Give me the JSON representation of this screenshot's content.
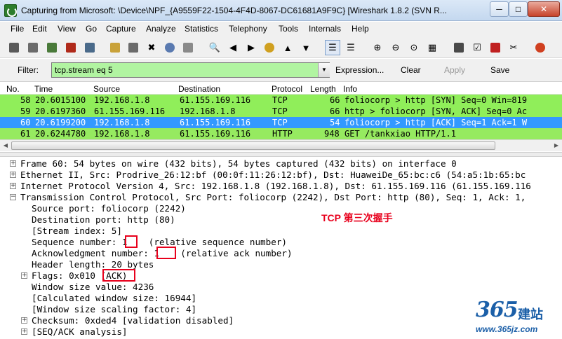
{
  "window": {
    "title": "Capturing from Microsoft: \\Device\\NPF_{A9559F22-1504-4F4D-8067-DC61681A9F9C}   [Wireshark 1.8.2  (SVN R...",
    "min_label": "─",
    "max_label": "□",
    "close_label": "✕"
  },
  "menu": [
    "File",
    "Edit",
    "View",
    "Go",
    "Capture",
    "Analyze",
    "Statistics",
    "Telephony",
    "Tools",
    "Internals",
    "Help"
  ],
  "toolbar": {
    "icons": [
      {
        "name": "interfaces-icon",
        "color": "#5a5a5a"
      },
      {
        "name": "options-icon",
        "color": "#6b6b6b"
      },
      {
        "name": "start-capture-icon",
        "color": "#4a7a3a"
      },
      {
        "name": "stop-capture-icon",
        "color": "#b02a1a"
      },
      {
        "name": "restart-capture-icon",
        "color": "#4a6a8a"
      },
      {
        "name": "open-file-icon",
        "color": "#c9a23a"
      },
      {
        "name": "save-file-icon",
        "color": "#6b6b6b"
      },
      {
        "name": "close-file-icon",
        "color": "#6b6b6b"
      },
      {
        "name": "reload-icon",
        "color": "#5a7ab0"
      },
      {
        "name": "print-icon",
        "color": "#6b6b6b"
      },
      {
        "name": "find-packet-icon",
        "color": "#6b6b6b"
      },
      {
        "name": "go-back-icon",
        "color": "#3a9a2a"
      },
      {
        "name": "go-forward-icon",
        "color": "#3a9a2a"
      },
      {
        "name": "go-to-packet-icon",
        "color": "#d0a020"
      },
      {
        "name": "go-first-icon",
        "color": "#3a9a2a"
      },
      {
        "name": "go-last-icon",
        "color": "#3a9a2a"
      },
      {
        "name": "colorize-icon",
        "color": "#4a4a4a"
      },
      {
        "name": "auto-scroll-icon",
        "color": "#4a4a4a"
      },
      {
        "name": "zoom-in-icon",
        "color": "#4a4a4a"
      },
      {
        "name": "zoom-out-icon",
        "color": "#4a4a4a"
      },
      {
        "name": "normal-size-icon",
        "color": "#4a4a4a"
      },
      {
        "name": "resize-columns-icon",
        "color": "#4a4a4a"
      },
      {
        "name": "capture-filters-icon",
        "color": "#4a4a4a"
      },
      {
        "name": "display-filters-icon",
        "color": "#4a4a4a"
      },
      {
        "name": "coloring-rules-icon",
        "color": "#c02020"
      },
      {
        "name": "preferences-icon",
        "color": "#4a4a4a"
      },
      {
        "name": "help-icon",
        "color": "#d04020"
      }
    ]
  },
  "filter": {
    "label": "Filter:",
    "value": "tcp.stream eq 5",
    "color": "#b1f4a1",
    "buttons": {
      "expression": "Expression...",
      "clear": "Clear",
      "apply": "Apply",
      "save": "Save"
    }
  },
  "packet_list": {
    "columns": [
      "No.",
      "Time",
      "Source",
      "Destination",
      "Protocol",
      "Length",
      "Info"
    ],
    "rows": [
      {
        "no": "58",
        "time": "20.6015100",
        "source": "192.168.1.8",
        "destination": "61.155.169.116",
        "protocol": "TCP",
        "length": "66",
        "info": "foliocorp > http [SYN] Seq=0 Win=819",
        "style": "green"
      },
      {
        "no": "59",
        "time": "20.6197360",
        "source": "61.155.169.116",
        "destination": "192.168.1.8",
        "protocol": "TCP",
        "length": "66",
        "info": "http > foliocorp [SYN, ACK] Seq=0 Ac",
        "style": "green"
      },
      {
        "no": "60",
        "time": "20.6199200",
        "source": "192.168.1.8",
        "destination": "61.155.169.116",
        "protocol": "TCP",
        "length": "54",
        "info": "foliocorp > http [ACK] Seq=1 Ack=1 W",
        "style": "selected"
      },
      {
        "no": "61",
        "time": "20.6244780",
        "source": "192.168.1.8",
        "destination": "61.155.169.116",
        "protocol": "HTTP",
        "length": "948",
        "info": "GET /tankxiao HTTP/1.1",
        "style": "green2"
      }
    ],
    "colors": {
      "green": "#90ee5a",
      "selected": "#3399ff"
    }
  },
  "details": {
    "lines": [
      {
        "text": "Frame 60: 54 bytes on wire (432 bits), 54 bytes captured (432 bits) on interface 0",
        "indent": 0,
        "expander": "+"
      },
      {
        "text": "Ethernet II, Src: Prodrive_26:12:bf (00:0f:11:26:12:bf), Dst: HuaweiDe_65:bc:c6 (54:a5:1b:65:bc",
        "indent": 0,
        "expander": "+"
      },
      {
        "text": "Internet Protocol Version 4, Src: 192.168.1.8 (192.168.1.8), Dst: 61.155.169.116 (61.155.169.116",
        "indent": 0,
        "expander": "+"
      },
      {
        "text": "Transmission Control Protocol, Src Port: foliocorp (2242), Dst Port: http (80), Seq: 1, Ack: 1,",
        "indent": 0,
        "expander": "−"
      },
      {
        "text": "Source port: foliocorp (2242)",
        "indent": 1,
        "expander": ""
      },
      {
        "text": "Destination port: http (80)",
        "indent": 1,
        "expander": ""
      },
      {
        "text": "[Stream index: 5]",
        "indent": 1,
        "expander": ""
      },
      {
        "text": "Sequence number: 1    (relative sequence number)",
        "indent": 1,
        "expander": ""
      },
      {
        "text": "Acknowledgment number: 1    (relative ack number)",
        "indent": 1,
        "expander": ""
      },
      {
        "text": "Header length: 20 bytes",
        "indent": 1,
        "expander": ""
      },
      {
        "text": "Flags: 0x010 (ACK)",
        "indent": 1,
        "expander": "+"
      },
      {
        "text": "Window size value: 4236",
        "indent": 1,
        "expander": ""
      },
      {
        "text": "[Calculated window size: 16944]",
        "indent": 1,
        "expander": ""
      },
      {
        "text": "[Window size scaling factor: 4]",
        "indent": 1,
        "expander": ""
      },
      {
        "text": "Checksum: 0xded4 [validation disabled]",
        "indent": 1,
        "expander": "+"
      },
      {
        "text": "[SEQ/ACK analysis]",
        "indent": 1,
        "expander": "+"
      }
    ]
  },
  "annotation": "TCP 第三次握手",
  "watermark": {
    "number": "365",
    "brand": "建站",
    "url": "www.365jz.com"
  }
}
